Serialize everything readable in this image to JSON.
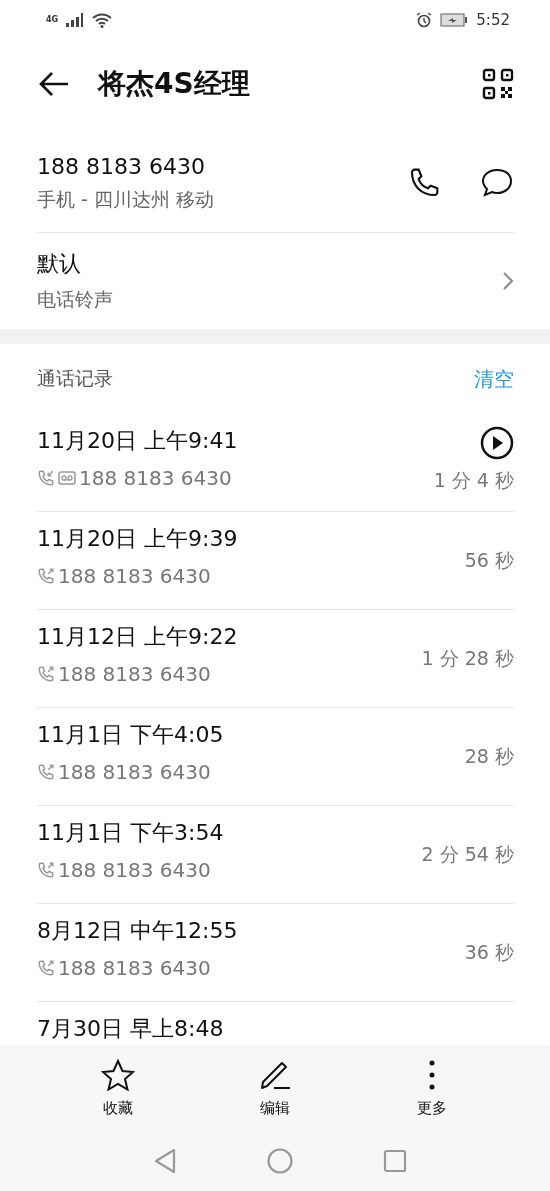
{
  "status_bar": {
    "network": "4G",
    "time": "5:52"
  },
  "header": {
    "title": "将杰4S经理"
  },
  "phone": {
    "number": "188 8183 6430",
    "description": "手机 - 四川达州 移动"
  },
  "ringtone": {
    "title": "默认",
    "subtitle": "电话铃声"
  },
  "call_log": {
    "title": "通话记录",
    "clear_label": "清空",
    "calls": [
      {
        "time": "11月20日 上午9:41",
        "kind": "incoming",
        "voicemail": true,
        "number": "188 8183 6430",
        "duration": "1 分 4 秒"
      },
      {
        "time": "11月20日 上午9:39",
        "kind": "outgoing",
        "voicemail": false,
        "number": "188 8183 6430",
        "duration": "56 秒"
      },
      {
        "time": "11月12日 上午9:22",
        "kind": "outgoing",
        "voicemail": false,
        "number": "188 8183 6430",
        "duration": "1 分 28 秒"
      },
      {
        "time": "11月1日 下午4:05",
        "kind": "outgoing",
        "voicemail": false,
        "number": "188 8183 6430",
        "duration": "28 秒"
      },
      {
        "time": "11月1日 下午3:54",
        "kind": "outgoing",
        "voicemail": false,
        "number": "188 8183 6430",
        "duration": "2 分 54 秒"
      },
      {
        "time": "8月12日 中午12:55",
        "kind": "outgoing",
        "voicemail": false,
        "number": "188 8183 6430",
        "duration": "36 秒"
      },
      {
        "time": "7月30日 早上8:48"
      }
    ]
  },
  "toolbar": [
    {
      "label": "收藏",
      "kind": "favorite"
    },
    {
      "label": "编辑",
      "kind": "edit"
    },
    {
      "label": "更多",
      "kind": "more"
    }
  ]
}
